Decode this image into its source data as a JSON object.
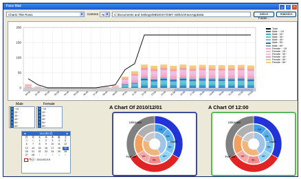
{
  "window": {
    "title": "Face Mail",
    "min": "_",
    "max": "□",
    "close": "x"
  },
  "toolbar": {
    "source_combo": "Chart1 Title Row1",
    "camera_label": "Camera",
    "camera_combo": "N/A",
    "path": "C:\\Documents and Settings\\MEDOSYS\\MY SD\\trio\\FaceAppData",
    "select_folder": "Select Folder...",
    "statistics": "Statistics"
  },
  "chart_data": {
    "type": "bar",
    "categories": [
      "00:00",
      "01:00",
      "02:00",
      "03:00",
      "04:00",
      "05:00",
      "06:00",
      "07:00",
      "08:00",
      "09:00",
      "10:00",
      "11:00",
      "12:00",
      "13:00",
      "14:00",
      "15:00",
      "16:00",
      "17:00",
      "18:00",
      "19:00",
      "20:00",
      "21:00",
      "22:00",
      "23:00"
    ],
    "ylim": [
      0,
      200
    ],
    "yticks": [
      "0",
      "50",
      "100",
      "150",
      "200"
    ],
    "series": [
      {
        "name": "Total",
        "values": [
          30,
          10,
          0,
          0,
          0,
          0,
          0,
          0,
          5,
          10,
          60,
          80,
          175,
          175,
          175,
          175,
          175,
          175,
          175,
          175,
          175,
          175,
          175,
          175
        ]
      },
      {
        "name": "Male : ~19",
        "values": [
          0,
          0,
          0,
          0,
          0,
          0,
          0,
          0,
          0,
          0,
          2,
          3,
          5,
          4,
          5,
          4,
          5,
          5,
          4,
          5,
          4,
          5,
          5,
          4
        ]
      },
      {
        "name": "Male : 20~",
        "values": [
          0,
          0,
          0,
          0,
          0,
          0,
          0,
          0,
          0,
          0,
          2,
          3,
          6,
          5,
          6,
          5,
          6,
          5,
          6,
          6,
          5,
          6,
          5,
          6
        ]
      },
      {
        "name": "Male : 30~",
        "values": [
          0,
          0,
          0,
          0,
          0,
          0,
          0,
          0,
          0,
          0,
          3,
          4,
          8,
          7,
          8,
          7,
          8,
          7,
          8,
          7,
          8,
          7,
          8,
          7
        ]
      },
      {
        "name": "Male : 40~",
        "values": [
          0,
          0,
          0,
          0,
          0,
          0,
          0,
          0,
          0,
          0,
          2,
          3,
          6,
          5,
          6,
          5,
          6,
          5,
          6,
          5,
          6,
          5,
          6,
          5
        ]
      },
      {
        "name": "Male : 50~",
        "values": [
          0,
          0,
          0,
          0,
          0,
          0,
          0,
          0,
          0,
          0,
          2,
          2,
          5,
          5,
          5,
          5,
          5,
          5,
          5,
          5,
          5,
          5,
          5,
          5
        ]
      },
      {
        "name": "Male : 60~",
        "values": [
          0,
          0,
          0,
          0,
          0,
          0,
          0,
          0,
          0,
          0,
          1,
          2,
          4,
          4,
          4,
          4,
          4,
          4,
          4,
          4,
          4,
          4,
          4,
          4
        ]
      },
      {
        "name": "Female : ~19",
        "values": [
          3,
          1,
          0,
          0,
          0,
          0,
          0,
          0,
          1,
          2,
          5,
          8,
          8,
          9,
          8,
          9,
          8,
          9,
          8,
          9,
          8,
          9,
          8,
          9
        ]
      },
      {
        "name": "Female : 20~",
        "values": [
          3,
          1,
          0,
          0,
          0,
          0,
          0,
          0,
          1,
          2,
          5,
          8,
          9,
          8,
          9,
          8,
          9,
          8,
          9,
          8,
          9,
          8,
          9,
          8
        ]
      },
      {
        "name": "Female : 30~",
        "values": [
          2,
          1,
          0,
          0,
          0,
          0,
          0,
          0,
          1,
          1,
          5,
          7,
          8,
          8,
          8,
          8,
          8,
          8,
          8,
          8,
          8,
          8,
          8,
          8
        ]
      },
      {
        "name": "Female : 40~",
        "values": [
          2,
          1,
          0,
          0,
          0,
          0,
          0,
          0,
          1,
          1,
          4,
          6,
          7,
          7,
          7,
          7,
          7,
          7,
          7,
          7,
          7,
          7,
          7,
          7
        ]
      },
      {
        "name": "Female : 50~",
        "values": [
          1,
          0,
          0,
          0,
          0,
          0,
          0,
          0,
          0,
          1,
          3,
          5,
          6,
          6,
          6,
          6,
          6,
          6,
          6,
          6,
          6,
          6,
          6,
          6
        ]
      },
      {
        "name": "Female : 60~",
        "values": [
          1,
          0,
          0,
          0,
          0,
          0,
          0,
          0,
          0,
          1,
          3,
          4,
          5,
          5,
          5,
          5,
          5,
          5,
          5,
          5,
          5,
          5,
          5,
          5
        ]
      }
    ],
    "colors": [
      "#000000",
      "#1f77b4",
      "#3b9fd8",
      "#5cc7c7",
      "#70b8e0",
      "#2a6fb0",
      "#7aa8d0",
      "#f6a5c0",
      "#f4b6d8",
      "#e8c0e8",
      "#f0a0a0",
      "#f7c08a",
      "#f2d070"
    ]
  },
  "lists": {
    "male_label": "Male",
    "female_label": "Female",
    "male_items": [
      "~19",
      "20~",
      "30~",
      "40~",
      "50~",
      "60~"
    ],
    "female_items": [
      "~19",
      "20~",
      "30~",
      "40~",
      "50~",
      "60~"
    ]
  },
  "calendar": {
    "header": "2011年2月",
    "prev": "◄",
    "next": "►",
    "weekdays": [
      "日",
      "月",
      "火",
      "水",
      "木",
      "金",
      "土"
    ],
    "days": [
      "30",
      "31",
      "1",
      "2",
      "3",
      "4",
      "5",
      "6",
      "7",
      "8",
      "9",
      "10",
      "11",
      "12",
      "13",
      "14",
      "15",
      "16",
      "17",
      "18",
      "19",
      "20",
      "21",
      "22",
      "23",
      "24",
      "25",
      "26",
      "27",
      "28",
      "1",
      "2",
      "3",
      "4",
      "5"
    ],
    "selected_index": 20,
    "today": "今日 : 2011/02/19"
  },
  "donut_left": {
    "title": "A Chart Of 2010/12/01",
    "outer_labels": [
      "Unknown",
      "Female",
      "Male"
    ],
    "inner_labels": [
      "~19",
      "20~",
      "30~",
      "40~",
      "50~",
      "60~"
    ],
    "accent": "#3b4a9a"
  },
  "donut_right": {
    "title": "A Chart Of 12:00",
    "outer_labels": [
      "Unknown",
      "Female",
      "Male"
    ],
    "inner_labels": [
      "~19",
      "20~",
      "30~",
      "40~",
      "50~",
      "60~"
    ],
    "accent": "#59b85c"
  }
}
